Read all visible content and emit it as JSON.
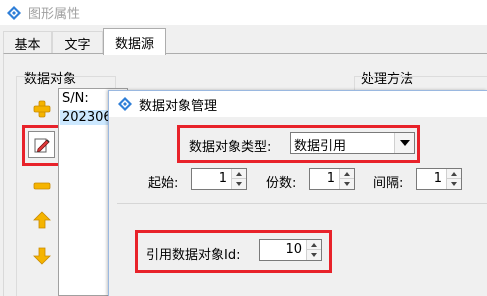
{
  "window": {
    "title": "图形属性"
  },
  "tabs": [
    {
      "label": "基本"
    },
    {
      "label": "文字"
    },
    {
      "label": "数据源"
    }
  ],
  "data_object_group": {
    "label": "数据对象"
  },
  "processing_group": {
    "label": "处理方法"
  },
  "list": {
    "items": [
      "S/N:",
      "202306"
    ]
  },
  "toolbar": {
    "add_icon": "plus-icon",
    "edit_icon": "pencil-edit-icon",
    "remove_icon": "minus-icon",
    "up_icon": "arrow-up-icon",
    "down_icon": "arrow-down-icon",
    "accent_color": "#f5b400"
  },
  "highlight_color": "#e8222a",
  "dialog": {
    "title": "数据对象管理",
    "type_label": "数据对象类型:",
    "type_value": "数据引用",
    "start_label": "起始:",
    "start_value": "1",
    "copies_label": "份数:",
    "copies_value": "1",
    "interval_label": "间隔:",
    "interval_value": "1",
    "ref_id_label": "引用数据对象Id:",
    "ref_id_value": "10"
  }
}
